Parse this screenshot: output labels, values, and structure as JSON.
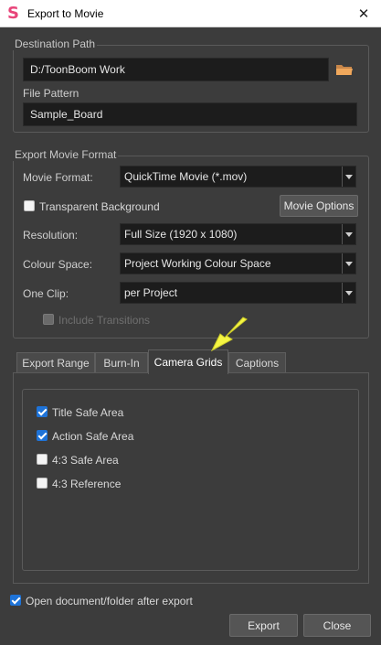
{
  "window": {
    "title": "Export to Movie",
    "app_icon": "S",
    "close_glyph": "✕"
  },
  "destination": {
    "group_title": "Destination Path",
    "path_value": "D:/ToonBoom Work",
    "browse_icon": "folder-icon",
    "file_pattern_label": "File Pattern",
    "file_pattern_value": "Sample_Board"
  },
  "format": {
    "group_title": "Export Movie Format",
    "movie_format_label": "Movie Format:",
    "movie_format_value": "QuickTime Movie (*.mov)",
    "transparent_label": "Transparent Background",
    "transparent_checked": false,
    "movie_options_label": "Movie Options",
    "resolution_label": "Resolution:",
    "resolution_value": "Full Size (1920 x 1080)",
    "colour_space_label": "Colour Space:",
    "colour_space_value": "Project Working Colour Space",
    "one_clip_label": "One Clip:",
    "one_clip_value": "per Project",
    "include_transitions_label": "Include Transitions",
    "include_transitions_enabled": false
  },
  "tabs": [
    {
      "label": "Export Range",
      "active": false
    },
    {
      "label": "Burn-In",
      "active": false
    },
    {
      "label": "Camera Grids",
      "active": true
    },
    {
      "label": "Captions",
      "active": false
    }
  ],
  "camera_grids": [
    {
      "label": "Title Safe Area",
      "checked": true
    },
    {
      "label": "Action Safe Area",
      "checked": true
    },
    {
      "label": "4:3 Safe Area",
      "checked": false
    },
    {
      "label": "4:3 Reference",
      "checked": false
    }
  ],
  "footer": {
    "open_after_label": "Open document/folder after export",
    "open_after_checked": true,
    "export_label": "Export",
    "close_label": "Close"
  },
  "colors": {
    "background": "#3c3c3c",
    "field": "#1c1c1c",
    "checkbox_accent": "#1e73d8",
    "annotation_arrow": "#f5f542",
    "app_icon": "#e8457a"
  }
}
